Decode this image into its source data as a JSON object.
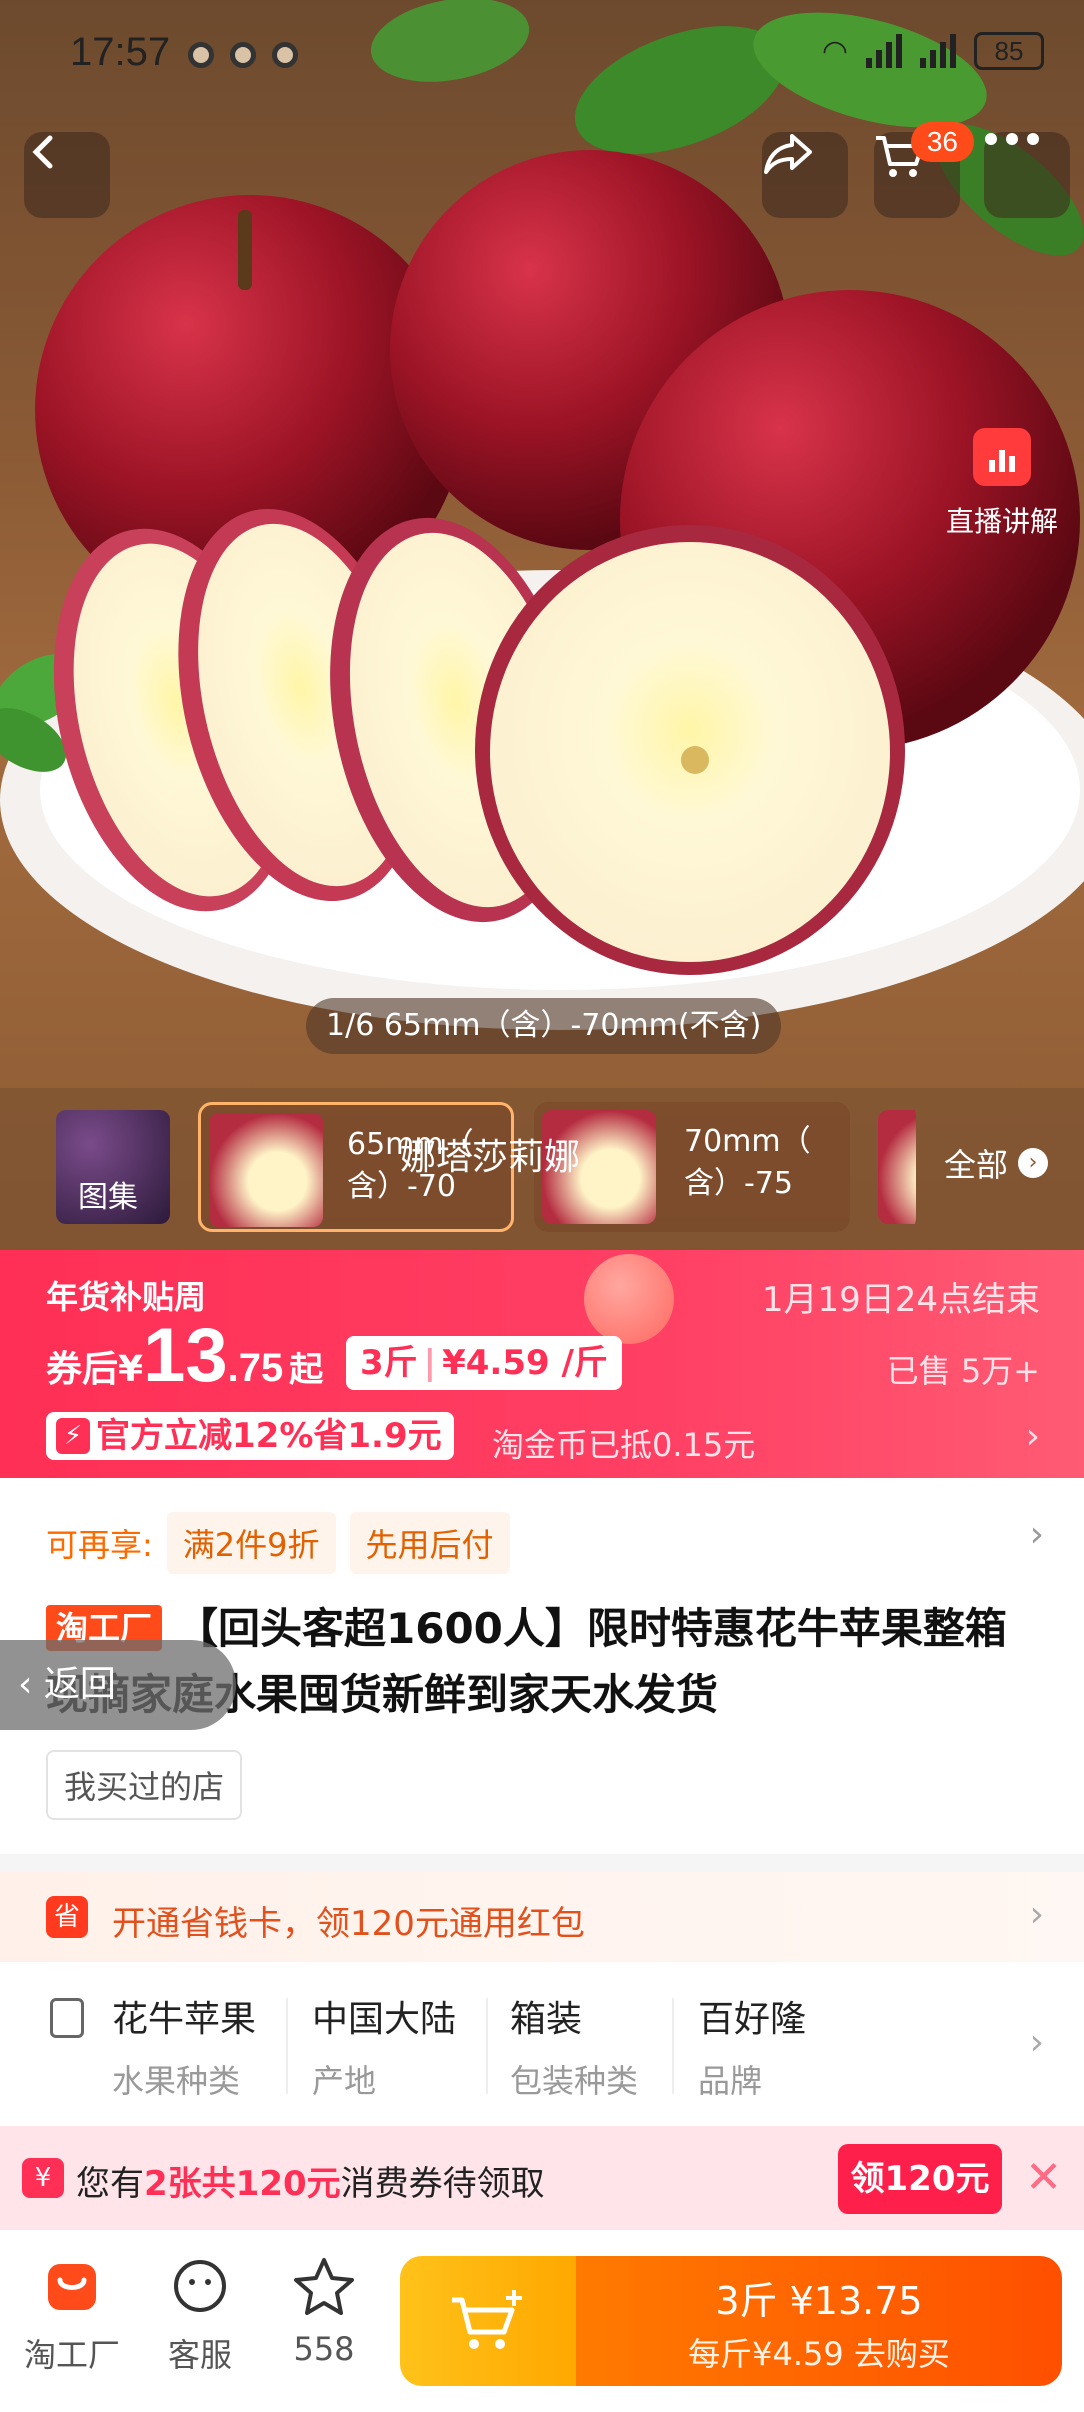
{
  "status_bar": {
    "time": "17:57",
    "battery": "85"
  },
  "header": {
    "cart_count": "36"
  },
  "hero": {
    "live_label": "直播讲解",
    "image_counter": "1/6 65mm（含）-70mm(不含)",
    "watermark": "娜塔莎莉娜"
  },
  "thumbnails": [
    {
      "label": "图集"
    },
    {
      "label_l1": "65mm（",
      "label_l2": "含）-70"
    },
    {
      "label_l1": "70mm（",
      "label_l2": "含）-75"
    }
  ],
  "thumbs_all_label": "全部",
  "price_banner": {
    "event_name": "年货补贴周",
    "ends_at": "1月19日24点结束",
    "coupon_prefix": "券后",
    "currency": "¥",
    "price_int": "13",
    "price_dec": ".75",
    "price_suffix": "起",
    "unit_weight": "3斤",
    "unit_price": "¥4.59 /斤",
    "sold": "已售 5万+",
    "promo_text": "官方立减12%省1.9元",
    "coin_text": "淘金币已抵0.15元"
  },
  "product": {
    "extra_label": "可再享:",
    "extra_tags": [
      "满2件9折",
      "先用后付"
    ],
    "brand_tag": "淘工厂",
    "title": "【回头客超1600人】限时特惠花牛苹果整箱现摘家庭水果囤货新鲜到家天水发货",
    "shop_tag": "我买过的店",
    "back_pill": "返回"
  },
  "savings_card": {
    "text": "开通省钱卡，领120元通用红包"
  },
  "attributes": [
    {
      "value": "花牛苹果",
      "key": "水果种类"
    },
    {
      "value": "中国大陆",
      "key": "产地"
    },
    {
      "value": "箱装",
      "key": "包装种类"
    },
    {
      "value": "百好隆",
      "key": "品牌"
    }
  ],
  "coupon_bar": {
    "text_pre": "您有",
    "text_em": "2张共120元",
    "text_post": "消费券待领取",
    "button": "领120元"
  },
  "bottom_nav": {
    "store": "淘工厂",
    "service": "客服",
    "favorites": "558",
    "buy_line1": "3斤 ¥13.75",
    "buy_line2": "每斤¥4.59  去购买"
  },
  "colors": {
    "accent": "#ff2f55",
    "orange": "#ff6a00",
    "buy_yellow": "#ffb300"
  }
}
